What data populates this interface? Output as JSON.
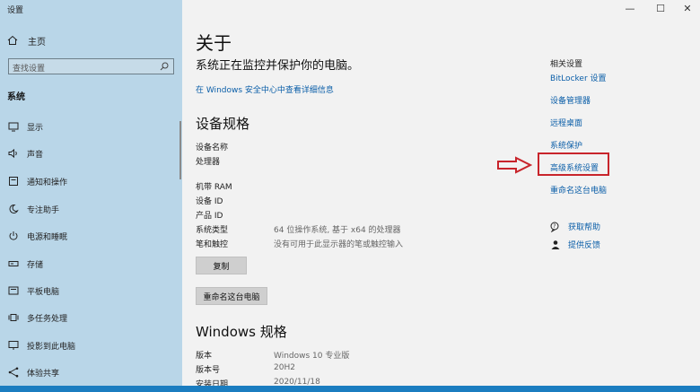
{
  "window": {
    "title": "设置",
    "controls": {
      "minimize": "—",
      "maximize": "☐",
      "close": "✕"
    }
  },
  "sidebar": {
    "home": "主页",
    "search_placeholder": "查找设置",
    "section": "系统",
    "items": [
      {
        "label": "显示",
        "icon": "display-icon"
      },
      {
        "label": "声音",
        "icon": "sound-icon"
      },
      {
        "label": "通知和操作",
        "icon": "notification-icon"
      },
      {
        "label": "专注助手",
        "icon": "moon-icon"
      },
      {
        "label": "电源和睡眠",
        "icon": "power-icon"
      },
      {
        "label": "存储",
        "icon": "storage-icon"
      },
      {
        "label": "平板电脑",
        "icon": "tablet-icon"
      },
      {
        "label": "多任务处理",
        "icon": "multitask-icon"
      },
      {
        "label": "投影到此电脑",
        "icon": "projection-icon"
      },
      {
        "label": "体验共享",
        "icon": "share-icon"
      }
    ]
  },
  "main": {
    "title": "关于",
    "protect_text": "系统正在监控并保护你的电脑。",
    "security_link": "在 Windows 安全中心中查看详细信息",
    "device_spec": {
      "heading": "设备规格",
      "rows": [
        {
          "label": "设备名称",
          "value": ""
        },
        {
          "label": "处理器",
          "value": ""
        },
        {
          "label": "机带 RAM",
          "value": ""
        },
        {
          "label": "设备 ID",
          "value": ""
        },
        {
          "label": "产品 ID",
          "value": ""
        },
        {
          "label": "系统类型",
          "value": "64 位操作系统, 基于 x64 的处理器"
        },
        {
          "label": "笔和触控",
          "value": "没有可用于此显示器的笔或触控输入"
        }
      ],
      "copy_button": "复制",
      "rename_button": "重命名这台电脑"
    },
    "windows_spec": {
      "heading": "Windows 规格",
      "rows": [
        {
          "label": "版本",
          "value": "Windows 10 专业版"
        },
        {
          "label": "版本号",
          "value": "20H2"
        },
        {
          "label": "安装日期",
          "value": "2020/11/18"
        }
      ]
    }
  },
  "related": {
    "heading": "相关设置",
    "links": [
      "BitLocker 设置",
      "设备管理器",
      "远程桌面",
      "系统保护",
      "高级系统设置",
      "重命名这台电脑"
    ],
    "help": "获取帮助",
    "feedback": "提供反馈"
  },
  "colors": {
    "sidebar": "#b9d6e8",
    "link": "#0a5ea8",
    "highlight": "#c8242b"
  }
}
